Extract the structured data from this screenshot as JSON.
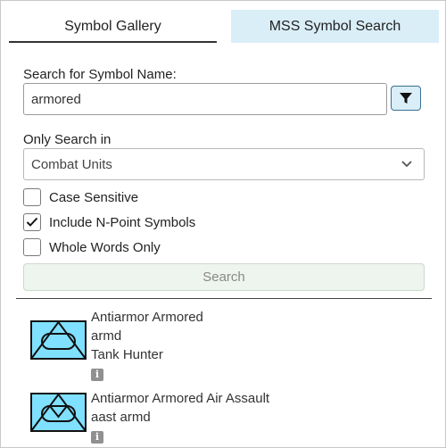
{
  "tabs": [
    {
      "label": "Symbol Gallery",
      "active": false
    },
    {
      "label": "MSS Symbol Search",
      "active": true
    }
  ],
  "search": {
    "name_label": "Search for Symbol Name:",
    "value": "armored",
    "filter_icon": "filter-icon"
  },
  "scope": {
    "label": "Only Search in",
    "selected": "Combat Units"
  },
  "options": [
    {
      "label": "Case Sensitive",
      "checked": false
    },
    {
      "label": "Include N-Point Symbols",
      "checked": true
    },
    {
      "label": "Whole Words Only",
      "checked": false
    }
  ],
  "search_button": {
    "label": "Search",
    "enabled": false
  },
  "results": [
    {
      "name": "Antiarmor Armored",
      "lines": [
        "armd",
        "Tank Hunter"
      ],
      "symbol": "antiarmor-armored-symbol",
      "info_glyph": "i"
    },
    {
      "name": "Antiarmor Armored Air Assault",
      "lines": [
        "aast armd"
      ],
      "symbol": "antiarmor-armored-air-assault-symbol",
      "info_glyph": "i"
    }
  ],
  "colors": {
    "active_tab_bg": "#daeef8",
    "symbol_fill": "#80e0ff",
    "button_disabled_bg": "#eef4ee"
  }
}
